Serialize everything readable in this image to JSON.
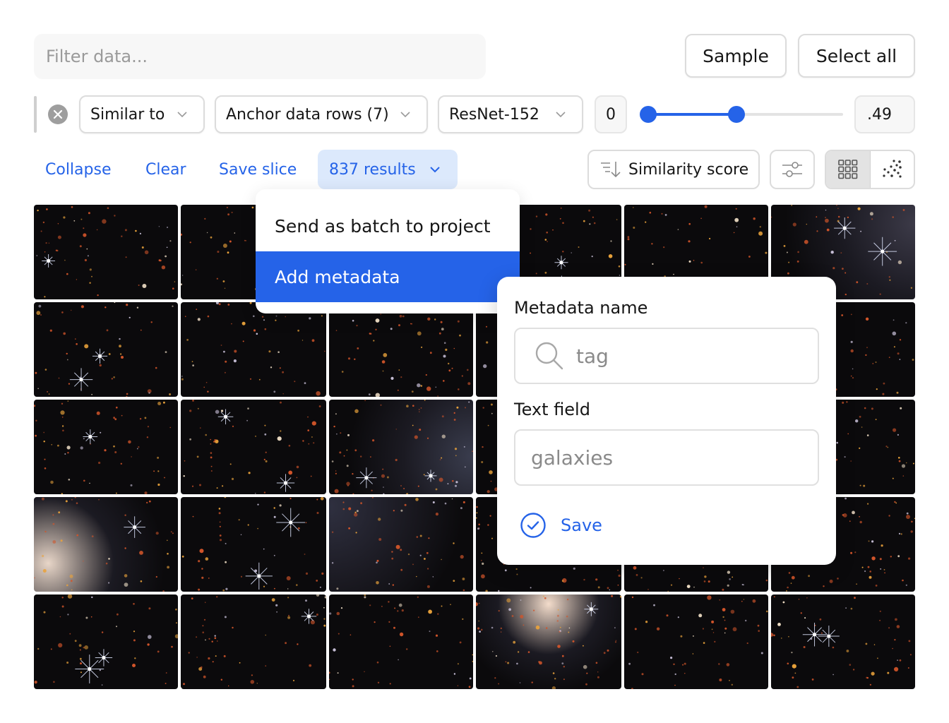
{
  "toolbar": {
    "filter_placeholder": "Filter data...",
    "filter_value": "",
    "sample_label": "Sample",
    "select_all_label": "Select all"
  },
  "filter_row": {
    "clear_icon": "close-circle-icon",
    "condition": "Similar to",
    "anchor": "Anchor data rows (7)",
    "model": "ResNet-152",
    "range_min": "0",
    "range_max": ".49",
    "slider": {
      "min": 0,
      "max": 1,
      "low": 0,
      "high": 0.49
    }
  },
  "actions": {
    "collapse_label": "Collapse",
    "clear_label": "Clear",
    "save_slice_label": "Save slice",
    "results_label": "837 results",
    "sort_label": "Similarity score",
    "sort_icon": "sort-descending-icon",
    "filter_settings_icon": "sliders-icon",
    "view_modes": [
      {
        "name": "grid-view",
        "icon": "grid-icon",
        "active": true
      },
      {
        "name": "scatter-view",
        "icon": "scatter-icon",
        "active": false
      }
    ]
  },
  "results_menu": {
    "items": [
      {
        "label": "Send as batch to project",
        "active": false
      },
      {
        "label": "Add metadata",
        "active": true
      }
    ]
  },
  "metadata_popover": {
    "name_label": "Metadata name",
    "name_value": "tag",
    "name_icon": "search-icon",
    "text_label": "Text field",
    "text_value": "galaxies",
    "save_label": "Save",
    "save_icon": "check-circle-icon"
  },
  "grid": {
    "rows": 5,
    "columns": 6,
    "tile_count": 30,
    "tile_content": "space telescope deep-field image"
  },
  "colors": {
    "accent": "#2563e8",
    "accent_light": "#dce9fc",
    "border": "#dcdcdc",
    "input_bg": "#f7f7f7"
  }
}
